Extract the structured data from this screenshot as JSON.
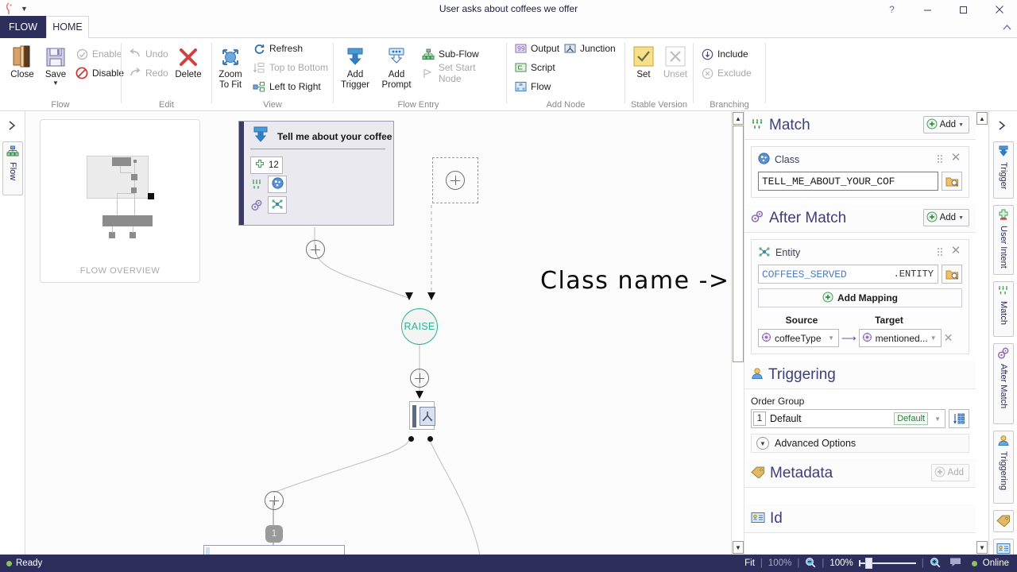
{
  "window": {
    "title": "User asks about coffees we offer",
    "help_icon": "?",
    "minimize_icon": "minimize-icon",
    "maximize_icon": "maximize-icon",
    "close_icon": "close-icon",
    "collapse_ribbon_icon": "chevron-up-icon"
  },
  "ribbon": {
    "tabs": [
      {
        "label": "FLOW",
        "active": false
      },
      {
        "label": "HOME",
        "active": true
      }
    ],
    "groups": [
      {
        "name": "Flow",
        "label": "Flow",
        "items": [
          {
            "label": "Close",
            "kind": "big",
            "enabled": true
          },
          {
            "label": "Save",
            "kind": "big",
            "enabled": true,
            "has_dropdown": true
          },
          {
            "label": "Enable",
            "kind": "small",
            "enabled": false
          },
          {
            "label": "Disable",
            "kind": "small",
            "enabled": true
          }
        ]
      },
      {
        "name": "Edit",
        "label": "Edit",
        "items": [
          {
            "label": "Undo",
            "kind": "small",
            "enabled": false
          },
          {
            "label": "Redo",
            "kind": "small",
            "enabled": false
          },
          {
            "label": "Delete",
            "kind": "big",
            "enabled": true
          }
        ]
      },
      {
        "name": "View",
        "label": "View",
        "items": [
          {
            "label": "Zoom To Fit",
            "kind": "big",
            "enabled": true
          },
          {
            "label": "Refresh",
            "kind": "small",
            "enabled": true
          },
          {
            "label": "Top to Bottom",
            "kind": "small",
            "enabled": false
          },
          {
            "label": "Left to Right",
            "kind": "small",
            "enabled": true
          }
        ]
      },
      {
        "name": "Flow Entry",
        "label": "Flow Entry",
        "items": [
          {
            "label": "Add Trigger",
            "kind": "big",
            "enabled": true
          },
          {
            "label": "Add Prompt",
            "kind": "big",
            "enabled": true
          },
          {
            "label": "Sub-Flow",
            "kind": "small",
            "enabled": true
          },
          {
            "label": "Set Start Node",
            "kind": "small",
            "enabled": false
          }
        ]
      },
      {
        "name": "Add Node",
        "label": "Add Node",
        "items": [
          {
            "label": "Output",
            "kind": "small",
            "enabled": true
          },
          {
            "label": "Junction",
            "kind": "small",
            "enabled": true
          },
          {
            "label": "Script",
            "kind": "small",
            "enabled": true
          },
          {
            "label": "Flow",
            "kind": "small",
            "enabled": true
          }
        ]
      },
      {
        "name": "Stable Version",
        "label": "Stable Version",
        "items": [
          {
            "label": "Set",
            "kind": "big",
            "enabled": true
          },
          {
            "label": "Unset",
            "kind": "big",
            "enabled": false
          }
        ]
      },
      {
        "name": "Branching",
        "label": "Branching",
        "items": [
          {
            "label": "Include",
            "kind": "small",
            "enabled": true
          },
          {
            "label": "Exclude",
            "kind": "small",
            "enabled": false
          }
        ]
      }
    ]
  },
  "left_strip": {
    "expand_icon": "chevron-right-icon",
    "tabs": [
      {
        "label": "Flow",
        "icon": "flow-icon",
        "active": true
      }
    ]
  },
  "canvas": {
    "overview_label": "FLOW OVERVIEW",
    "node": {
      "title": "Tell me about your coffee",
      "icon": "trigger-icon",
      "count_badge": "12",
      "count_icon": "plus-icon",
      "match_icon": "match-icon",
      "class_icon": "class-icon",
      "after_match_icon": "after-match-icon",
      "entity_icon": "entity-icon"
    },
    "add_placeholder_icon": "plus-in-box-icon",
    "raise_label": "RAISE",
    "junction_icon": "junction-icon",
    "branch_number": "1"
  },
  "annotation": {
    "text": "Class name ->"
  },
  "panel": {
    "sections": [
      {
        "id": "match",
        "title": "Match",
        "icon": "match-icon",
        "add_label": "Add",
        "add_enabled": true,
        "cards": [
          {
            "label": "Class",
            "icon": "class-icon",
            "value": "TELL_ME_ABOUT_YOUR_COF",
            "browse_icon": "browse-folder-icon",
            "close_icon": "close-icon",
            "grip_icon": "drag-grip-icon"
          }
        ]
      },
      {
        "id": "after-match",
        "title": "After Match",
        "icon": "after-match-icon",
        "add_label": "Add",
        "add_enabled": true,
        "cards": [
          {
            "label": "Entity",
            "icon": "entity-icon",
            "value": "COFFEES_SERVED",
            "suffix": ".ENTITY",
            "browse_icon": "browse-folder-icon",
            "close_icon": "close-icon",
            "grip_icon": "drag-grip-icon",
            "add_mapping_label": "Add Mapping",
            "add_mapping_icon": "plus-circle-icon",
            "mapping_headers": {
              "source": "Source",
              "target": "Target"
            },
            "mapping": {
              "source": "coffeeType",
              "target": "mentioned...",
              "arrow_icon": "arrow-right-icon",
              "remove_icon": "close-icon",
              "source_icon": "variable-icon",
              "target_icon": "variable-icon"
            }
          }
        ]
      },
      {
        "id": "triggering",
        "title": "Triggering",
        "icon": "triggering-icon",
        "order_group_label": "Order Group",
        "order_number": "1",
        "order_value": "Default",
        "order_tag": "Default",
        "sort_icon": "sort-order-icon",
        "advanced_label": "Advanced Options",
        "advanced_icon": "chevron-down-circle-icon"
      },
      {
        "id": "metadata",
        "title": "Metadata",
        "icon": "metadata-tag-icon",
        "add_label": "Add",
        "add_enabled": false
      },
      {
        "id": "id",
        "title": "Id",
        "icon": "id-card-icon"
      }
    ]
  },
  "right_strip": {
    "collapse_icon": "chevron-left-icon",
    "tabs": [
      {
        "label": "Trigger",
        "icon": "trigger-icon"
      },
      {
        "label": "User Intent",
        "icon": "user-intent-icon"
      },
      {
        "label": "Match",
        "icon": "match-icon"
      },
      {
        "label": "After Match",
        "icon": "after-match-icon"
      },
      {
        "label": "Triggering",
        "icon": "triggering-icon"
      },
      {
        "label": "",
        "icon": "metadata-tag-icon"
      },
      {
        "label": "",
        "icon": "id-card-icon"
      }
    ]
  },
  "status_bar": {
    "state": "Ready",
    "state_icon": "status-dot-icon",
    "fit_label": "Fit",
    "fit_percent": "100%",
    "zoom_out_icon": "zoom-out-icon",
    "zoom_percent": "100%",
    "zoom_in_icon": "zoom-in-icon",
    "comment_icon": "comment-icon",
    "connection": "Online",
    "connection_icon": "online-dot-icon"
  },
  "colors": {
    "accent_dark": "#2e2e5c",
    "panel_heading": "#3e3e7a",
    "raise_green": "#2eb396",
    "online_green": "#8fbf63"
  }
}
